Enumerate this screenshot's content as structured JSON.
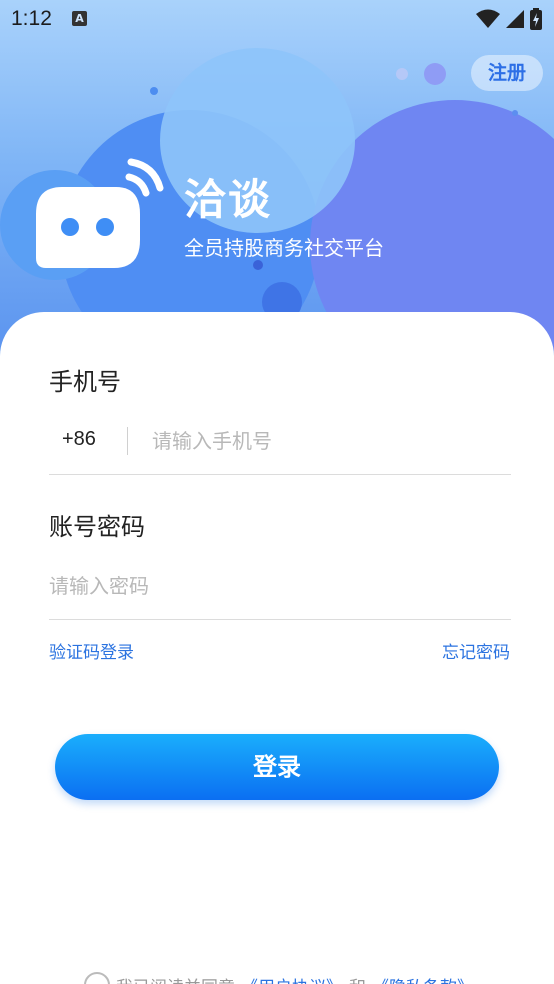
{
  "status_bar": {
    "time": "1:12",
    "notification_icon": "A"
  },
  "header": {
    "register_label": "注册",
    "app_name": "洽谈",
    "slogan": "全员持股商务社交平台"
  },
  "form": {
    "phone_label": "手机号",
    "country_code": "+86",
    "phone_placeholder": "请输入手机号",
    "password_label": "账号密码",
    "password_placeholder": "请输入密码",
    "sms_login_label": "验证码登录",
    "forgot_password_label": "忘记密码",
    "login_label": "登录"
  },
  "agreement": {
    "prefix": "我已阅读并同意",
    "user_agreement": "《用户协议》",
    "conjunction": "和",
    "privacy_policy": "《隐私条款》"
  },
  "colors": {
    "accent": "#2b73e0",
    "button_top": "#1aaefc",
    "button_bottom": "#0b6ff2",
    "hero_top": "#a9d2fb"
  }
}
